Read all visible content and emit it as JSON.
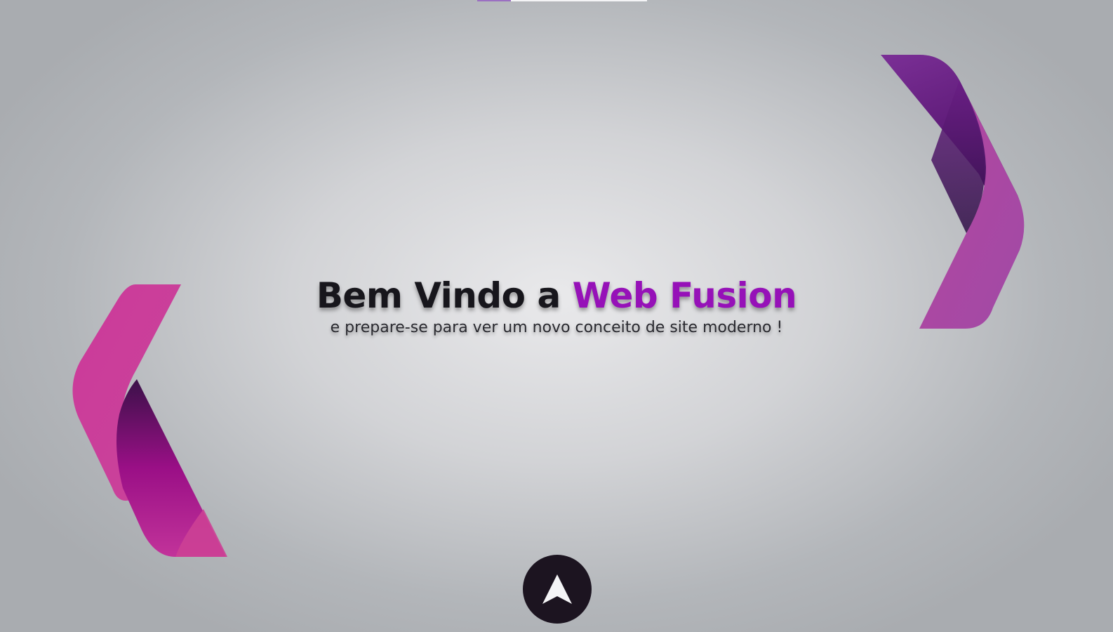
{
  "hero": {
    "title_prefix": "Bem Vindo a ",
    "title_brand": "Web Fusion",
    "subtitle": "e prepare-se para ver um novo conceito de site moderno !"
  },
  "scroll_top_button": {
    "icon": "arrow-up-icon"
  },
  "colors": {
    "brand": "#9611b8",
    "title": "#17161c",
    "button_bg": "#1c1420",
    "ribbon_pink": "#cf3a98",
    "ribbon_purple": "#7a2a90"
  }
}
